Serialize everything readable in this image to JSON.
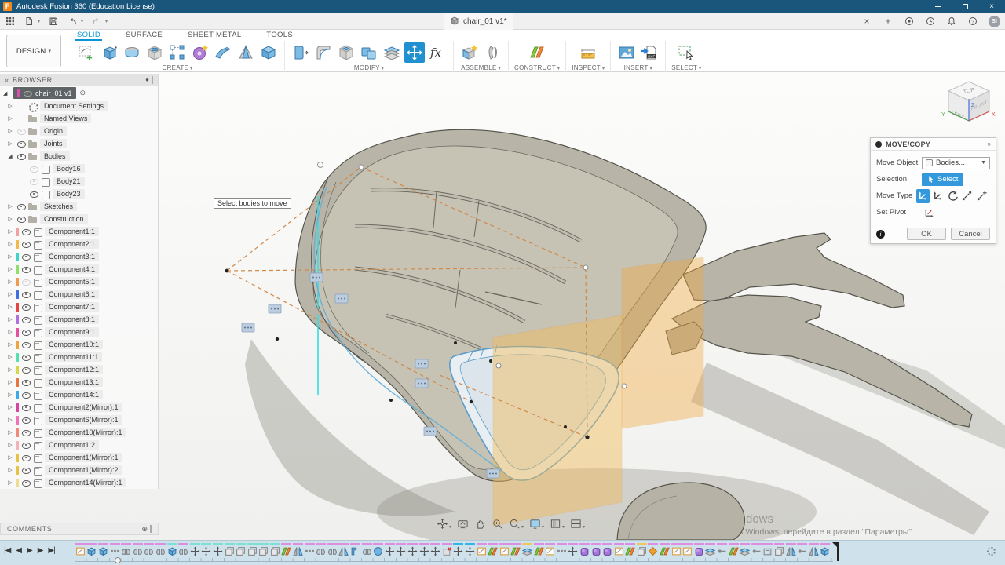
{
  "title_bar": {
    "app_title": "Autodesk Fusion 360 (Education License)",
    "logo_letter": "F",
    "close": "×"
  },
  "appbar": {
    "doc_tab": {
      "label": "chair_01 v1*"
    },
    "close_tab": "×",
    "new_tab": "+",
    "avatar": "SI"
  },
  "ribbon": {
    "workspace": "DESIGN",
    "tabs": [
      {
        "label": "SOLID",
        "active": true
      },
      {
        "label": "SURFACE"
      },
      {
        "label": "SHEET METAL"
      },
      {
        "label": "TOOLS"
      }
    ],
    "groups": [
      {
        "label": "CREATE",
        "icons": [
          "create-sketch",
          "extrude",
          "revolve",
          "hole",
          "sketch-pattern",
          "coil",
          "sweep",
          "loft",
          "box"
        ]
      },
      {
        "label": "MODIFY",
        "icons": [
          "press-pull",
          "fillet",
          "shell",
          "combine",
          "split-body",
          "move-copy",
          "change-parameters"
        ],
        "active_icon": "move-copy"
      },
      {
        "label": "ASSEMBLE",
        "icons": [
          "new-component",
          "joint"
        ]
      },
      {
        "label": "CONSTRUCT",
        "icons": [
          "construction-plane"
        ]
      },
      {
        "label": "INSPECT",
        "icons": [
          "measure"
        ]
      },
      {
        "label": "INSERT",
        "icons": [
          "canvas",
          "insert-dxf"
        ]
      },
      {
        "label": "SELECT",
        "icons": [
          "select"
        ]
      }
    ]
  },
  "browser": {
    "header": "BROWSER",
    "root": "chair_01 v1",
    "rows": [
      {
        "label": "Document Settings",
        "icon": "gear",
        "expand": true,
        "level": 1
      },
      {
        "label": "Named Views",
        "icon": "folder",
        "expand": true,
        "level": 1
      },
      {
        "label": "Origin",
        "icon": "folder",
        "eye": "dim",
        "expand": true,
        "level": 1
      },
      {
        "label": "Joints",
        "icon": "folder",
        "eye": "on",
        "expand": true,
        "level": 1
      },
      {
        "label": "Bodies",
        "icon": "folder",
        "eye": "on",
        "expand": "open",
        "level": 1
      },
      {
        "label": "Body16",
        "icon": "body",
        "eye": "dim",
        "level": 2
      },
      {
        "label": "Body21",
        "icon": "body",
        "eye": "dim",
        "level": 2
      },
      {
        "label": "Body23",
        "icon": "body",
        "eye": "on",
        "level": 2
      },
      {
        "label": "Sketches",
        "icon": "folder",
        "eye": "on",
        "expand": true,
        "level": 1
      },
      {
        "label": "Construction",
        "icon": "folder",
        "eye": "on",
        "expand": true,
        "level": 1
      },
      {
        "label": "Component1:1",
        "icon": "comp",
        "eye": "on",
        "expand": true,
        "level": 1,
        "bar": "#f2a29e"
      },
      {
        "label": "Component2:1",
        "icon": "comp",
        "eye": "on",
        "expand": true,
        "level": 1,
        "bar": "#f2b84b"
      },
      {
        "label": "Component3:1",
        "icon": "comp",
        "eye": "on",
        "expand": true,
        "level": 1,
        "bar": "#3fd4c5"
      },
      {
        "label": "Component4:1",
        "icon": "comp",
        "eye": "on",
        "expand": true,
        "level": 1,
        "bar": "#8ddf66"
      },
      {
        "label": "Component5:1",
        "icon": "comp",
        "eye": "dim",
        "expand": true,
        "level": 1,
        "bar": "#f09a4e"
      },
      {
        "label": "Component6:1",
        "icon": "comp",
        "eye": "on",
        "expand": true,
        "level": 1,
        "bar": "#3f6fe0"
      },
      {
        "label": "Component7:1",
        "icon": "comp",
        "eye": "on",
        "expand": true,
        "level": 1,
        "bar": "#e84343"
      },
      {
        "label": "Component8:1",
        "icon": "comp",
        "eye": "on",
        "expand": true,
        "level": 1,
        "bar": "#b06fe0"
      },
      {
        "label": "Component9:1",
        "icon": "comp",
        "eye": "on",
        "expand": true,
        "level": 1,
        "bar": "#e84f9e"
      },
      {
        "label": "Component10:1",
        "icon": "comp",
        "eye": "on",
        "expand": true,
        "level": 1,
        "bar": "#f0a43f"
      },
      {
        "label": "Component11:1",
        "icon": "comp",
        "eye": "on",
        "expand": true,
        "level": 1,
        "bar": "#55e0b0"
      },
      {
        "label": "Component12:1",
        "icon": "comp",
        "eye": "on",
        "expand": true,
        "level": 1,
        "bar": "#d6d64a"
      },
      {
        "label": "Component13:1",
        "icon": "comp",
        "eye": "on",
        "expand": true,
        "level": 1,
        "bar": "#e8743f"
      },
      {
        "label": "Component14:1",
        "icon": "comp",
        "eye": "on",
        "expand": true,
        "level": 1,
        "bar": "#3fa8e8"
      },
      {
        "label": "Component2(Mirror):1",
        "icon": "comp",
        "eye": "on",
        "expand": true,
        "level": 1,
        "bar": "#d843a0"
      },
      {
        "label": "Component6(Mirror):1",
        "icon": "comp",
        "eye": "on",
        "expand": true,
        "level": 1,
        "bar": "#f073b5"
      },
      {
        "label": "Component10(Mirror):1",
        "icon": "comp",
        "eye": "on",
        "expand": true,
        "level": 1,
        "bar": "#f08a78"
      },
      {
        "label": "Component1:2",
        "icon": "comp",
        "eye": "on",
        "expand": true,
        "level": 1,
        "bar": "#f4b3b6"
      },
      {
        "label": "Component1(Mirror):1",
        "icon": "comp",
        "eye": "on",
        "expand": true,
        "level": 1,
        "bar": "#e8c243"
      },
      {
        "label": "Component1(Mirror):2",
        "icon": "comp",
        "eye": "on",
        "expand": true,
        "level": 1,
        "bar": "#e8c243"
      },
      {
        "label": "Component14(Mirror):1",
        "icon": "comp",
        "eye": "on",
        "expand": true,
        "level": 1,
        "bar": "#f0dc90"
      }
    ]
  },
  "canvas": {
    "tooltip": "Select bodies to move"
  },
  "viewcube": {
    "top": "TOP",
    "left": "LEFT",
    "front": "FRONT",
    "x": "X",
    "y": "Y",
    "z": "Z"
  },
  "dialog": {
    "title": "MOVE/COPY",
    "move_object_label": "Move Object",
    "move_object_value": "Bodies...",
    "selection_label": "Selection",
    "selection_value": "Select",
    "move_type_label": "Move Type",
    "set_pivot_label": "Set Pivot",
    "ok": "OK",
    "cancel": "Cancel"
  },
  "navbar": {
    "items": [
      {
        "icon": "orbit",
        "dd": true
      },
      {
        "icon": "look-at",
        "dd": false
      },
      {
        "icon": "pan",
        "dd": false
      },
      {
        "icon": "zoom",
        "dd": false
      },
      {
        "icon": "fit",
        "dd": true
      },
      {
        "icon": "display-settings",
        "dd": true
      },
      {
        "icon": "grid-settings",
        "dd": true
      },
      {
        "icon": "viewports",
        "dd": true
      }
    ]
  },
  "comments": {
    "label": "COMMENTS"
  },
  "watermark": {
    "line1": "Активация Windows",
    "line2": "Чтобы активировать Windows, перейдите в раздел \"Параметры\"."
  },
  "timeline": {
    "playback": [
      "|◀",
      "◀",
      "▶",
      "▶",
      "▶|"
    ],
    "groups": {
      "p": "#dd8ee0",
      "c": "#7ce0d3",
      "b": "#33b5e5",
      "y": "#efc75e"
    },
    "features": [
      [
        "sk",
        "p"
      ],
      [
        "ex",
        "p"
      ],
      [
        "ex",
        "p"
      ],
      [
        "pat",
        "p"
      ],
      [
        "mi",
        "p"
      ],
      [
        "mi",
        "p"
      ],
      [
        "mi",
        "p"
      ],
      [
        "mi",
        "p"
      ],
      [
        "ex",
        "c"
      ],
      [
        "mi",
        "p"
      ],
      [
        "mv",
        "c"
      ],
      [
        "mv",
        "c"
      ],
      [
        "mv",
        "c"
      ],
      [
        "cp",
        "c"
      ],
      [
        "cp",
        "c"
      ],
      [
        "cp",
        "c"
      ],
      [
        "cp",
        "c"
      ],
      [
        "cp",
        "c"
      ],
      [
        "pl",
        "p"
      ],
      [
        "tr",
        "p"
      ],
      [
        "pat",
        "p"
      ],
      [
        "mi",
        "p"
      ],
      [
        "mi",
        "p"
      ],
      [
        "tr",
        "p"
      ],
      [
        "co",
        "p"
      ],
      [
        "mi",
        "p"
      ],
      [
        "sp",
        "p"
      ],
      [
        "mv",
        "p"
      ],
      [
        "mv",
        "p"
      ],
      [
        "mv",
        "p"
      ],
      [
        "mv",
        "p"
      ],
      [
        "mv",
        "p"
      ],
      [
        "de",
        "p"
      ],
      [
        "mv",
        "b"
      ],
      [
        "mv",
        "b"
      ],
      [
        "sk",
        "p"
      ],
      [
        "pl",
        "p"
      ],
      [
        "sk",
        "p"
      ],
      [
        "pl",
        "p"
      ],
      [
        "spl",
        "y"
      ],
      [
        "pl",
        "p"
      ],
      [
        "sk",
        "p"
      ],
      [
        "pat",
        "p"
      ],
      [
        "mv",
        "p"
      ],
      [
        "bo",
        "p"
      ],
      [
        "bo",
        "p"
      ],
      [
        "bo",
        "p"
      ],
      [
        "sk",
        "p"
      ],
      [
        "pl",
        "p"
      ],
      [
        "cp",
        "y"
      ],
      [
        "pt",
        "p"
      ],
      [
        "pl",
        "p"
      ],
      [
        "sk",
        "p"
      ],
      [
        "sk",
        "p"
      ],
      [
        "bo",
        "p"
      ],
      [
        "spl",
        "p"
      ],
      [
        "un",
        "p"
      ],
      [
        "pl",
        "p"
      ],
      [
        "spl",
        "p"
      ],
      [
        "un",
        "p"
      ],
      [
        "sh",
        "p"
      ],
      [
        "cp",
        "p"
      ],
      [
        "tr",
        "p"
      ],
      [
        "un",
        "p"
      ],
      [
        "tr",
        "p"
      ],
      [
        "ex",
        "p"
      ]
    ]
  }
}
